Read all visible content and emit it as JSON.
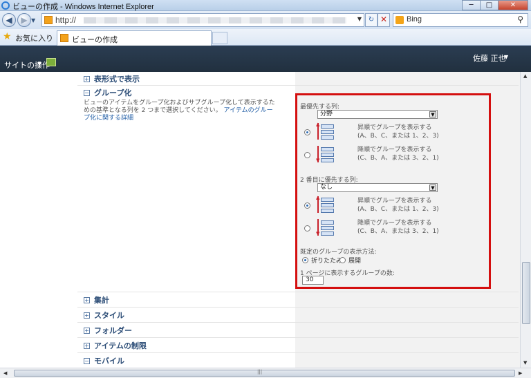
{
  "window": {
    "title": "ビューの作成 - Windows Internet Explorer",
    "minimize_glyph": "─",
    "maximize_glyph": "□",
    "close_glyph": "✕"
  },
  "browser": {
    "url": "http://",
    "search_engine": "Bing",
    "favorites_label": "お気に入り",
    "tab_title": "ビューの作成"
  },
  "ribbon": {
    "site_actions": "サイトの操作",
    "user_name": "佐藤 正也"
  },
  "sections": {
    "tabular": "表形式で表示",
    "group_by": "グループ化",
    "totals": "集計",
    "style": "スタイル",
    "folders": "フォルダー",
    "item_limit": "アイテムの制限",
    "mobile": "モバイル"
  },
  "group_description": {
    "text": "ビューのアイテムをグループ化およびサブグループ化して表示するための基準となる列を 2 つまで選択してください。",
    "link": "アイテムのグループ化に関する詳細"
  },
  "groupby_form": {
    "first_label": "最優先する列:",
    "first_value": "分野",
    "second_label": "2 番目に優先する列:",
    "second_value": "なし",
    "asc_line1": "昇順でグループを表示する",
    "asc_line2": "(A、B、C、または 1、2、3)",
    "desc_line1": "降順でグループを表示する",
    "desc_line2": "(C、B、A、または 3、2、1)",
    "default_label": "既定のグループの表示方法:",
    "collapse_label": "折りたたみ",
    "expand_label": "展開",
    "count_label": "1 ページに表示するグループの数:",
    "count_value": "30"
  },
  "colors": {
    "highlight_border": "#d40f0f",
    "ribbon_bg": "#2b3d52",
    "section_title": "#2b4c76",
    "link": "#2560a7"
  },
  "icons": [
    "ie-logo-icon",
    "back-arrow-icon",
    "forward-arrow-icon",
    "refresh-icon",
    "stop-icon",
    "bing-icon",
    "search-icon",
    "favorites-star-icon",
    "page-favicon",
    "edit-page-icon",
    "expand-icon",
    "collapse-icon",
    "ascending-sort-icon",
    "descending-sort-icon"
  ]
}
